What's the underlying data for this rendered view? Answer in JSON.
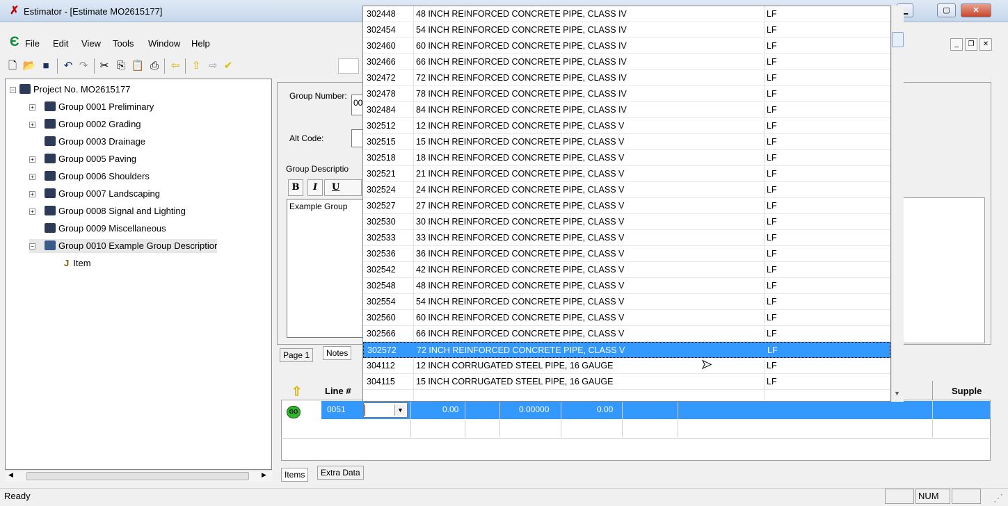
{
  "window": {
    "title": "Estimator - [Estimate MO2615177]"
  },
  "menu": [
    "File",
    "Edit",
    "View",
    "Tools",
    "Window",
    "Help"
  ],
  "tree": {
    "root": "Project No. MO2615177",
    "items": [
      "Group 0001 Preliminary",
      "Group 0002 Grading",
      "Group 0003 Drainage",
      "Group 0005 Paving",
      "Group 0006 Shoulders",
      "Group 0007 Landscaping",
      "Group 0008 Signal and Lighting",
      "Group 0009 Miscellaneous",
      "Group 0010 Example Group Descriptior"
    ],
    "child": "Item"
  },
  "group_panel": {
    "group_number_label": "Group Number:",
    "group_number_value": "00",
    "alt_code_label": "Alt Code:",
    "description_label": "Group Descriptio",
    "format_buttons": [
      "B",
      "I",
      "U"
    ],
    "description_text": "Example Group",
    "tabs": [
      "Page 1",
      "Notes"
    ]
  },
  "dropdown": {
    "rows": [
      [
        "302448",
        "48 INCH REINFORCED CONCRETE PIPE, CLASS IV",
        "LF"
      ],
      [
        "302454",
        "54 INCH REINFORCED CONCRETE PIPE, CLASS IV",
        "LF"
      ],
      [
        "302460",
        "60 INCH REINFORCED CONCRETE PIPE, CLASS IV",
        "LF"
      ],
      [
        "302466",
        "66 INCH REINFORCED CONCRETE PIPE, CLASS IV",
        "LF"
      ],
      [
        "302472",
        "72 INCH REINFORCED CONCRETE PIPE, CLASS IV",
        "LF"
      ],
      [
        "302478",
        "78 INCH REINFORCED CONCRETE PIPE, CLASS IV",
        "LF"
      ],
      [
        "302484",
        "84 INCH REINFORCED CONCRETE PIPE, CLASS IV",
        "LF"
      ],
      [
        "302512",
        "12 INCH REINFORCED CONCRETE PIPE, CLASS V",
        "LF"
      ],
      [
        "302515",
        "15 INCH REINFORCED CONCRETE PIPE, CLASS V",
        "LF"
      ],
      [
        "302518",
        "18 INCH REINFORCED CONCRETE PIPE, CLASS V",
        "LF"
      ],
      [
        "302521",
        "21 INCH REINFORCED CONCRETE PIPE, CLASS V",
        "LF"
      ],
      [
        "302524",
        "24 INCH REINFORCED CONCRETE PIPE, CLASS V",
        "LF"
      ],
      [
        "302527",
        "27 INCH REINFORCED CONCRETE PIPE, CLASS V",
        "LF"
      ],
      [
        "302530",
        "30 INCH REINFORCED CONCRETE PIPE, CLASS V",
        "LF"
      ],
      [
        "302533",
        "33 INCH REINFORCED CONCRETE PIPE, CLASS V",
        "LF"
      ],
      [
        "302536",
        "36 INCH REINFORCED CONCRETE PIPE, CLASS V",
        "LF"
      ],
      [
        "302542",
        "42 INCH REINFORCED CONCRETE PIPE, CLASS V",
        "LF"
      ],
      [
        "302548",
        "48 INCH REINFORCED CONCRETE PIPE, CLASS V",
        "LF"
      ],
      [
        "302554",
        "54 INCH REINFORCED CONCRETE PIPE, CLASS V",
        "LF"
      ],
      [
        "302560",
        "60 INCH REINFORCED CONCRETE PIPE, CLASS V",
        "LF"
      ],
      [
        "302566",
        "66 INCH REINFORCED CONCRETE PIPE, CLASS V",
        "LF"
      ],
      [
        "302572",
        "72 INCH REINFORCED CONCRETE PIPE, CLASS V",
        "LF"
      ],
      [
        "304112",
        "12 INCH CORRUGATED STEEL PIPE, 16 GAUGE",
        "LF"
      ],
      [
        "304115",
        "15 INCH CORRUGATED STEEL PIPE, 16 GAUGE",
        "LF"
      ]
    ],
    "selected_index": 21
  },
  "grid": {
    "header_line": "Line #",
    "header_supple": "Supple",
    "row": {
      "status": "GO",
      "line": "0051",
      "v1": "0.00",
      "v2": "0.00000",
      "v3": "0.00"
    }
  },
  "bottom_tabs": [
    "Items",
    "Extra Data"
  ],
  "status": {
    "text": "Ready",
    "num": "NUM"
  }
}
